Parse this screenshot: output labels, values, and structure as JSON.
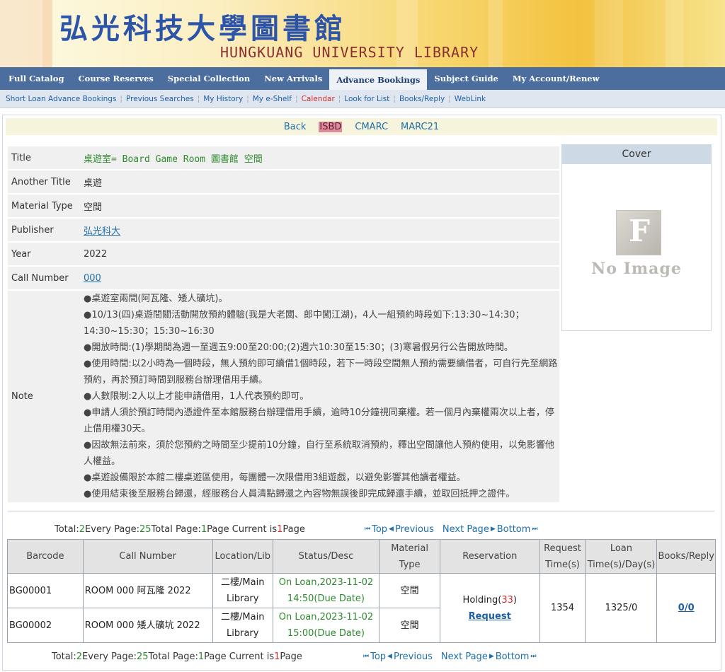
{
  "banner": {
    "title_cn": "弘光科技大學圖書館",
    "title_en": "HUNGKUANG UNIVERSITY LIBRARY"
  },
  "nav": {
    "tabs": [
      {
        "label": "Full Catalog",
        "active": false
      },
      {
        "label": "Course Reserves",
        "active": false
      },
      {
        "label": "Special Collection",
        "active": false
      },
      {
        "label": "New Arrivals",
        "active": false
      },
      {
        "label": "Advance Bookings",
        "active": true
      },
      {
        "label": "Subject Guide",
        "active": false
      },
      {
        "label": "My Account/Renew",
        "active": false
      }
    ]
  },
  "subnav": {
    "items": [
      {
        "label": "Short Loan Advance Bookings"
      },
      {
        "label": "Previous Searches"
      },
      {
        "label": "My History"
      },
      {
        "label": "My e-Shelf"
      },
      {
        "label": "Calendar"
      },
      {
        "label": "Look for List"
      },
      {
        "label": "Books/Reply"
      },
      {
        "label": "WebLink"
      }
    ]
  },
  "views": {
    "back": "Back",
    "isbd": "ISBD",
    "cmarc": "CMARC",
    "marc21": "MARC21"
  },
  "record": {
    "title_label": "Title",
    "title_value": "桌遊室= Board Game Room 圖書館 空間",
    "another_title_label": "Another Title",
    "another_title_value": "桌遊",
    "material_type_label": "Material Type",
    "material_type_value": "空間",
    "publisher_label": "Publisher",
    "publisher_value": "弘光科大",
    "year_label": "Year",
    "year_value": "2022",
    "call_number_label": "Call Number",
    "call_number_value": "000",
    "note_label": "Note",
    "notes": [
      "●桌遊室兩間(阿瓦隆、矮人礦坑)。",
      "●10/13(四)桌遊間關活動開放預約體驗(我是大老闆、郎中闖江湖)，4人一組預約時段如下:13:30~14:30；14:30~15:30；15:30~16:30",
      "●開放時間:(1)學期間為週一至週五9:00至20:00;(2)週六10:30至15:30；(3)寒暑假另行公告開放時間。",
      "●使用時間:以2小時為一個時段，無人預約即可續借1個時段，若下一時段空間無人預約需要續借者，可自行先至網路預約，再於預訂時間到服務台辦理借用手續。",
      "●人數限制:2人以上才能申請借用，1人代表預約即可。",
      "●申請人須於預訂時間內憑證件至本館服務台辦理借用手續，逾時10分鐘視同棄權。若一個月內棄權兩次以上者，停止借用權30天。",
      "●因故無法前來，須於您預約之時間至少提前10分鐘，自行至系統取消預約，釋出空間讓他人預約使用，以免影響他人權益。",
      "●桌遊設備限於本館二樓桌遊區使用，每團體一次限借用3組遊戲，以避免影響其他讀者權益。",
      "●使用結束後至服務台歸還，經服務台人員清點歸還之內容物無誤後即完成歸還手續，並取回抵押之證件。"
    ]
  },
  "cover": {
    "header": "Cover",
    "placeholder_letter": "F",
    "placeholder_text": "No Image"
  },
  "pager": {
    "total_label": "Total:",
    "total": "2",
    "every_page_label": " Every Page:",
    "every_page": "25",
    "total_page_label": " Total Page:",
    "total_page": "1",
    "page_current_label": "Page Current is",
    "current": "1",
    "page_word": "Page",
    "top": "Top",
    "previous": "Previous",
    "next": "Next Page",
    "bottom": "Bottom"
  },
  "holdings": {
    "headers": {
      "barcode": "Barcode",
      "call_number": "Call Number",
      "location": "Location/Lib",
      "status": "Status/Desc",
      "material_type": "Material Type",
      "reservation": "Reservation",
      "request_time": "Request Time(s)",
      "loan_time": "Loan Time(s)/Day(s)",
      "books_reply": "Books/Reply"
    },
    "rows": [
      {
        "barcode": "BG00001",
        "call_number": "ROOM 000 阿瓦隆 2022",
        "location": "二樓/Main Library",
        "status": "On Loan,2023-11-02 14:50(Due Date)",
        "material_type": "空間"
      },
      {
        "barcode": "BG00002",
        "call_number": "ROOM 000 矮人礦坑 2022",
        "location": "二樓/Main Library",
        "status": "On Loan,2023-11-02 15:00(Due Date)",
        "material_type": "空間"
      }
    ],
    "reservation": {
      "holding_label": "Holding(",
      "holding_count": "33",
      "holding_close": ")",
      "request_link": "Request"
    },
    "request_time": "1354",
    "loan_time": "1325/0",
    "books_reply": "0/0"
  }
}
